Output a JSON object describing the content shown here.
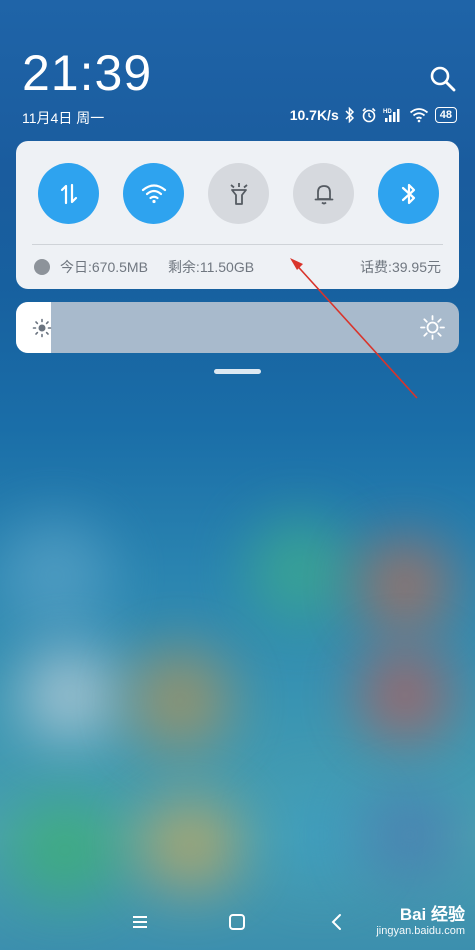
{
  "status_bar": {
    "time": "21:39",
    "date": "11月4日 周一",
    "net_speed": "10.7K/s",
    "battery": "48",
    "icons": [
      "bluetooth-icon",
      "alarm-icon",
      "hd-signal-icon",
      "wifi-icon",
      "battery-icon"
    ]
  },
  "quick_settings": {
    "tiles": [
      {
        "name": "mobile-data",
        "icon": "data-arrows-icon",
        "state": "on"
      },
      {
        "name": "wifi",
        "icon": "wifi-icon",
        "state": "on"
      },
      {
        "name": "flashlight",
        "icon": "flashlight-icon",
        "state": "off"
      },
      {
        "name": "mute",
        "icon": "bell-icon",
        "state": "off"
      },
      {
        "name": "bluetooth",
        "icon": "bluetooth-icon",
        "state": "on"
      }
    ],
    "data_today": "今日:670.5MB",
    "data_remaining": "剩余:11.50GB",
    "balance": "话费:39.95元"
  },
  "brightness": {
    "level": 0.08
  },
  "colors": {
    "accent": "#2ea3ef",
    "tile_off": "#d6d9de",
    "annotation_arrow": "#d9342b"
  },
  "watermark": {
    "brand": "Bai 经验",
    "url": "jingyan.baidu.com"
  }
}
